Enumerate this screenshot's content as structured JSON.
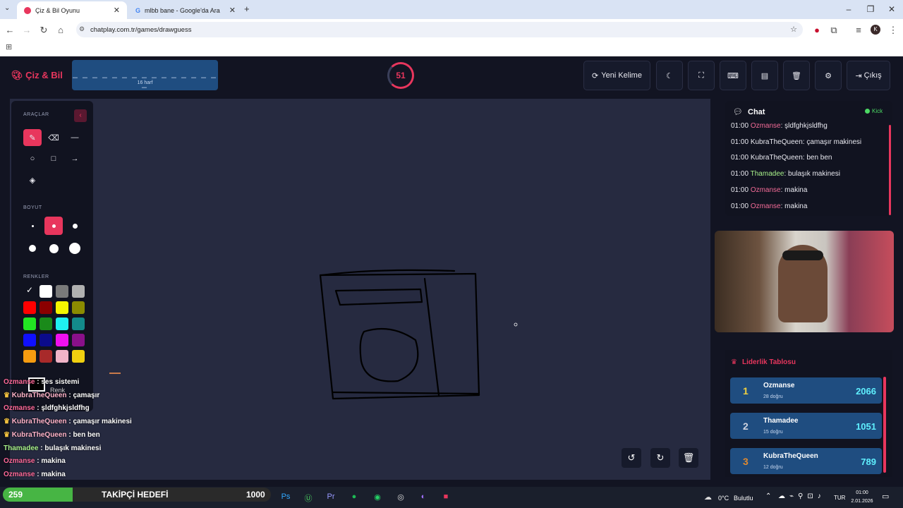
{
  "browser": {
    "tabs": [
      {
        "label": "Çiz & Bil Oyunu",
        "active": true
      },
      {
        "label": "mlbb bane - Google'da Ara",
        "active": false
      }
    ],
    "new_tab": "+",
    "url": "chatplay.com.tr/games/drawguess",
    "profile_initial": "K"
  },
  "header": {
    "logo": "Çiz & Bil",
    "word_dashes": "_ _ _ _ _ _ _ _ _ _ _ _ _ _ _ _",
    "word_hint": "16 harf",
    "timer": "51",
    "timer_fraction": 0.72,
    "new_word_label": "Yeni Kelime",
    "exit_label": "Çıkış"
  },
  "tools": {
    "title": "ARAÇLAR",
    "size_title": "BOYUT",
    "colors_title": "RENKLER",
    "custom_color_label": "Renk",
    "colors": [
      "#111111",
      "#ffffff",
      "#7a7a7a",
      "#b0b0b0",
      "#ff0000",
      "#8b0000",
      "#f5f500",
      "#8b8b00",
      "#22e622",
      "#1a8a1a",
      "#1ff0f0",
      "#138a8a",
      "#1010ff",
      "#0b0b8a",
      "#f010f0",
      "#8a108a",
      "#f59b10",
      "#a82a2a",
      "#f0b4c8",
      "#f0d010"
    ]
  },
  "overlay_chat": [
    {
      "user": "Ozmanse",
      "text": "ses sistemi",
      "type": "o"
    },
    {
      "user": "KubraTheQueen",
      "text": "çamaşır",
      "type": "k"
    },
    {
      "user": "Ozmanse",
      "text": "şldfghkjsldfhg",
      "type": "o"
    },
    {
      "user": "KubraTheQueen",
      "text": "çamaşır makinesi",
      "type": "k"
    },
    {
      "user": "KubraTheQueen",
      "text": "ben ben",
      "type": "k"
    },
    {
      "user": "Thamadee",
      "text": "bulaşık makinesi",
      "type": "t"
    },
    {
      "user": "Ozmanse",
      "text": "makina",
      "type": "o"
    },
    {
      "user": "Ozmanse",
      "text": "makina",
      "type": "o"
    }
  ],
  "chat": {
    "title": "Chat",
    "status": "Kick",
    "messages": [
      {
        "time": "01:00",
        "user": "Ozmanse",
        "text": "şldfghkjsldfhg",
        "type": "o"
      },
      {
        "time": "01:00",
        "user": "KubraTheQueen",
        "text": "çamaşır makinesi",
        "type": "k"
      },
      {
        "time": "01:00",
        "user": "KubraTheQueen",
        "text": "ben ben",
        "type": "k"
      },
      {
        "time": "01:00",
        "user": "Thamadee",
        "text": "bulaşık makinesi",
        "type": "t"
      },
      {
        "time": "01:00",
        "user": "Ozmanse",
        "text": "makina",
        "type": "o"
      },
      {
        "time": "01:00",
        "user": "Ozmanse",
        "text": "makina",
        "type": "o"
      }
    ]
  },
  "leaderboard": {
    "title": "Liderlik Tablosu",
    "rows": [
      {
        "rank": "1",
        "name": "Ozmanse",
        "sub": "28 doğru",
        "score": "2066",
        "color": "#f0d040"
      },
      {
        "rank": "2",
        "name": "Thamadee",
        "sub": "15 doğru",
        "score": "1051",
        "color": "#d0d4e0"
      },
      {
        "rank": "3",
        "name": "KubraTheQueen",
        "sub": "12 doğru",
        "score": "789",
        "color": "#e08a30"
      }
    ]
  },
  "stream_overlay": {
    "follower_count": "259",
    "goal_label": "TAKİPÇİ HEDEFİ",
    "goal_target": "1000",
    "goal_fraction": 0.26
  },
  "taskbar": {
    "weather": "0°C",
    "weather_text": "Bulutlu",
    "lang": "TUR",
    "time": "01:00",
    "date": "2.01.2026"
  }
}
